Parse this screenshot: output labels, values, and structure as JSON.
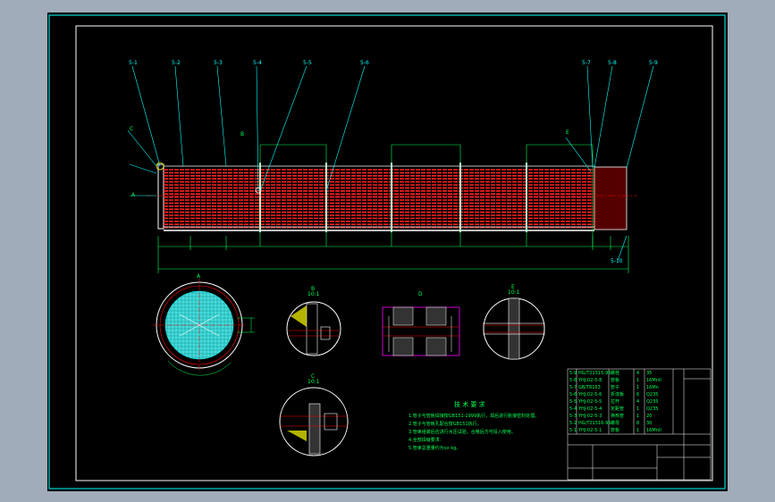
{
  "colors": {
    "background": "#000000",
    "frame": "#ffffff",
    "border": "#00ffff",
    "dimension": "#00ff55",
    "tubes": "#ff2222",
    "centerline": "#ff0000",
    "tube_sheet": "#00ffff",
    "section_hatch": "#ff00ff",
    "outer_bg": "#a0acb9"
  },
  "callouts": {
    "top": [
      "5-1",
      "5-2",
      "5-3",
      "5-4",
      "5-5",
      "5-6",
      "5-7",
      "5-8",
      "5-9"
    ],
    "right_bottom": "5-10"
  },
  "section_marks": {
    "a": "A",
    "b": "B",
    "c": "C",
    "d": "D",
    "e": "E"
  },
  "details": {
    "b_title": "B",
    "b_scale": "10:1",
    "c_title": "C",
    "c_scale": "10:1",
    "d_title": "D",
    "e_title": "E",
    "e_scale": "10:1"
  },
  "tech_req": {
    "title": "技 术 要 求",
    "lines": [
      "1.管子与管板焊接按GB151-1999执行，焊后进行胀接密封处理。",
      "2.管子与管板孔配合按GB151执行。",
      "3.管束组装后应进行水压试验，合格后方可投入使用。",
      "4.全部焊缝要求：",
      "5.管束总重量约为xx kg。"
    ]
  },
  "bom": {
    "rows": [
      {
        "no": "5-9",
        "code": "HG/T21515-95",
        "name": "螺栓",
        "qty": "4",
        "mat": "35"
      },
      {
        "no": "5-8",
        "code": "YHJ-02-5-8",
        "name": "管板",
        "qty": "1",
        "mat": "16MnII"
      },
      {
        "no": "5-7",
        "code": "GB/T8163",
        "name": "管子",
        "qty": "1",
        "mat": "16Mn"
      },
      {
        "no": "5-6",
        "code": "YHJ-02-5-6",
        "name": "折流板",
        "qty": "6",
        "mat": "Q235"
      },
      {
        "no": "5-5",
        "code": "YHJ-02-5-5",
        "name": "拉杆",
        "qty": "4",
        "mat": "Q235"
      },
      {
        "no": "5-4",
        "code": "YHJ-02-5-4",
        "name": "定距管",
        "qty": "1",
        "mat": "Q235"
      },
      {
        "no": "5-3",
        "code": "YHJ-02-5-3",
        "name": "换热管",
        "qty": "1",
        "mat": "20"
      },
      {
        "no": "5-2",
        "code": "HG/T21516-95",
        "name": "螺母",
        "qty": "8",
        "mat": "30"
      },
      {
        "no": "5-1",
        "code": "YHJ-02-5-1",
        "name": "管板",
        "qty": "1",
        "mat": "16MnII"
      }
    ]
  }
}
